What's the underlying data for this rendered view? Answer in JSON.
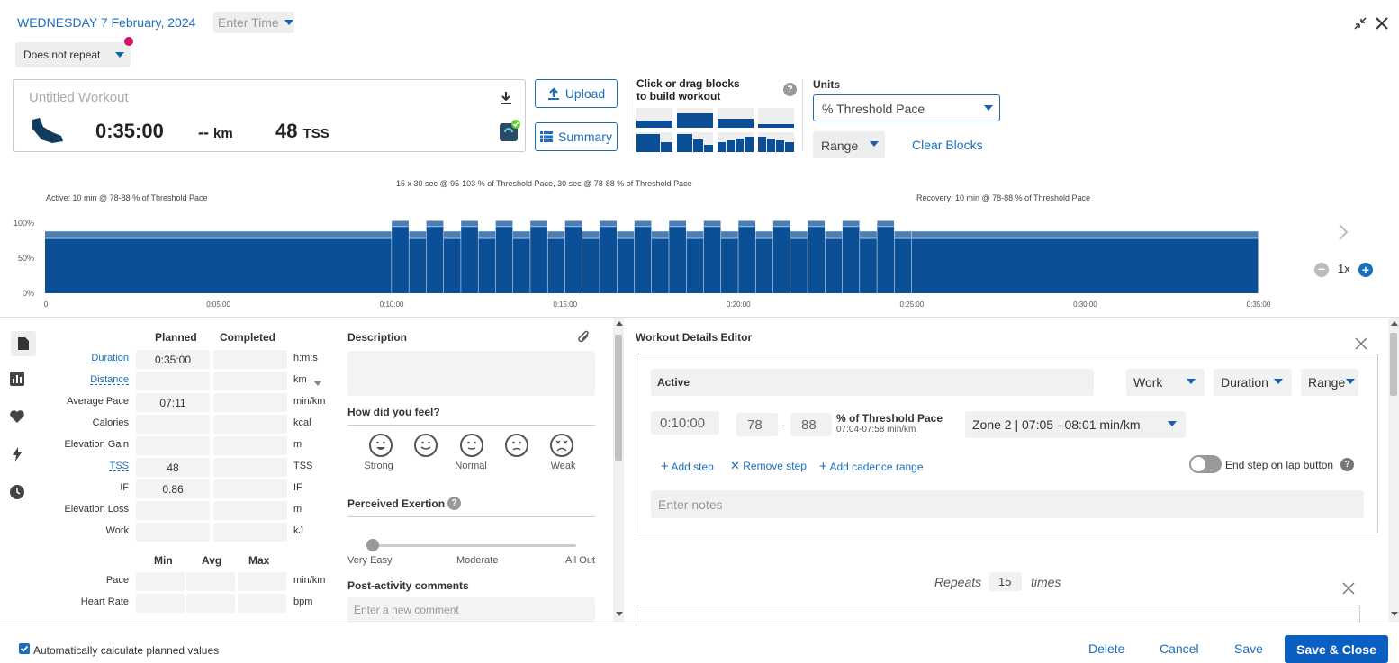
{
  "header": {
    "date": "WEDNESDAY 7 February, 2024",
    "time_placeholder": "Enter Time",
    "repeat": "Does not repeat"
  },
  "workout": {
    "title_placeholder": "Untitled Workout",
    "duration": "0:35:00",
    "distance": "--",
    "distance_unit": "km",
    "tss": "48",
    "tss_unit": "TSS"
  },
  "buttons": {
    "upload": "Upload",
    "summary": "Summary"
  },
  "builder": {
    "label_line1": "Click or drag blocks",
    "label_line2": "to build workout",
    "help": "?"
  },
  "units": {
    "label": "Units",
    "selected": "% Threshold Pace",
    "range": "Range",
    "clear_blocks": "Clear Blocks"
  },
  "chart": {
    "y_labels": [
      "100%",
      "50%",
      "0%"
    ],
    "x_labels": [
      "0",
      "0:05:00",
      "0:10:00",
      "0:15:00",
      "0:20:00",
      "0:25:00",
      "0:30:00",
      "0:35:00"
    ],
    "annotation_active": "Active: 10 min @ 78-88 % of Threshold Pace",
    "annotation_intervals": "15 x 30 sec @ 95-103 % of Threshold Pace, 30 sec @ 78-88 % of Threshold Pace",
    "annotation_recovery": "Recovery: 10 min @ 78-88 % of Threshold Pace",
    "zoom": "1x"
  },
  "chart_data": {
    "type": "bar",
    "x_range_min": [
      0,
      35
    ],
    "y_range_pct": [
      0,
      110
    ],
    "segments": [
      {
        "start_min": 0,
        "end_min": 10,
        "low": 78,
        "high": 88
      },
      {
        "intervals": 15,
        "work_sec": 30,
        "work_low": 95,
        "work_high": 103,
        "rest_sec": 30,
        "rest_low": 78,
        "rest_high": 88,
        "start_min": 10
      },
      {
        "start_min": 25,
        "end_min": 35,
        "low": 78,
        "high": 88
      }
    ]
  },
  "stats": {
    "col_planned": "Planned",
    "col_completed": "Completed",
    "rows": [
      {
        "label": "Duration",
        "planned": "0:35:00",
        "unit": "h:m:s",
        "link": true
      },
      {
        "label": "Distance",
        "planned": "",
        "unit": "km",
        "link": true
      },
      {
        "label": "Average Pace",
        "planned": "07:11",
        "unit": "min/km",
        "link": false
      },
      {
        "label": "Calories",
        "planned": "",
        "unit": "kcal",
        "link": false
      },
      {
        "label": "Elevation Gain",
        "planned": "",
        "unit": "m",
        "link": false
      },
      {
        "label": "TSS",
        "planned": "48",
        "unit": "TSS",
        "link": true
      },
      {
        "label": "IF",
        "planned": "0.86",
        "unit": "IF",
        "link": false
      },
      {
        "label": "Elevation Loss",
        "planned": "",
        "unit": "m",
        "link": false
      },
      {
        "label": "Work",
        "planned": "",
        "unit": "kJ",
        "link": false
      }
    ],
    "col_min": "Min",
    "col_avg": "Avg",
    "col_max": "Max",
    "rows2": [
      {
        "label": "Pace",
        "unit": "min/km"
      },
      {
        "label": "Heart Rate",
        "unit": "bpm"
      }
    ]
  },
  "feel": {
    "description_title": "Description",
    "question": "How did you feel?",
    "labels": [
      "Strong",
      "",
      "Normal",
      "",
      "Weak"
    ],
    "perceived": "Perceived Exertion",
    "scale": [
      "Very Easy",
      "Moderate",
      "All Out"
    ],
    "post_comments": "Post-activity comments",
    "comment_placeholder": "Enter a new comment"
  },
  "editor": {
    "title": "Workout Details Editor",
    "step_name": "Active",
    "type": "Work",
    "measure": "Duration",
    "range": "Range",
    "duration": "0:10:00",
    "low": "78",
    "high": "88",
    "dash": "-",
    "target_label": "% of Threshold Pace",
    "target_sub": "07:04-07:58 min/km",
    "zone": "Zone 2 | 07:05 - 08:01 min/km",
    "add_step": "Add step",
    "remove_step": "Remove step",
    "add_cadence": "Add cadence range",
    "end_lap": "End step on lap button",
    "notes_placeholder": "Enter notes",
    "repeats_label": "Repeats",
    "repeats": "15",
    "times": "times"
  },
  "footer": {
    "auto_calc": "Automatically calculate planned values",
    "delete": "Delete",
    "cancel": "Cancel",
    "save": "Save",
    "save_close": "Save & Close"
  }
}
